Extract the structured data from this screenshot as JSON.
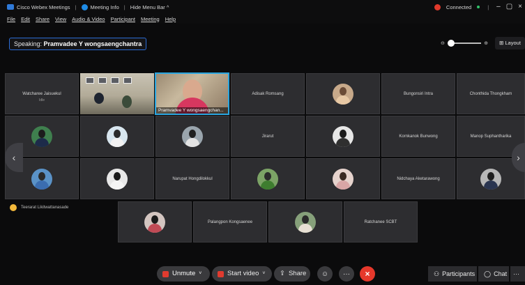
{
  "titlebar": {
    "app_name": "Cisco Webex Meetings",
    "meeting_info": "Meeting Info",
    "hide_menu": "Hide Menu Bar ^",
    "status": "Connected",
    "minimize": "–",
    "restore": "▢",
    "close": "×"
  },
  "menubar": {
    "items": [
      "File",
      "Edit",
      "Share",
      "View",
      "Audio & Video",
      "Participant",
      "Meeting",
      "Help"
    ]
  },
  "speaking": {
    "prefix": "Speaking:",
    "name": "Pramvadee Y wongsaengchantra"
  },
  "layout_label": "Layout",
  "tiles": {
    "watcharee": "Watcharee Jaisuekul",
    "watcharee_sub": "Idle",
    "active_speaker": "Pramvadee Y wongsaengchan...",
    "adisak": "Adisak Romsang",
    "bungonsiri": "Bungonsiri Intra",
    "chonthida": "Chonthida Thongkham",
    "jirarut": "Jirarut",
    "kornkanok": "Kornkanok Bunwong",
    "manop": "Manop Suphantharika",
    "narupat": "Narupat Hongdilokkul",
    "nidchaya": "Nidchaya Aketarawong",
    "teerarat": "Teerarat Likitwattanasade",
    "palangpon": "Palangpon Kongsaenee",
    "ratchanee": "Ratchanee SCBT"
  },
  "controls": {
    "unmute": "Unmute",
    "start_video": "Start video",
    "share": "Share",
    "participants": "Participants",
    "chat": "Chat"
  }
}
